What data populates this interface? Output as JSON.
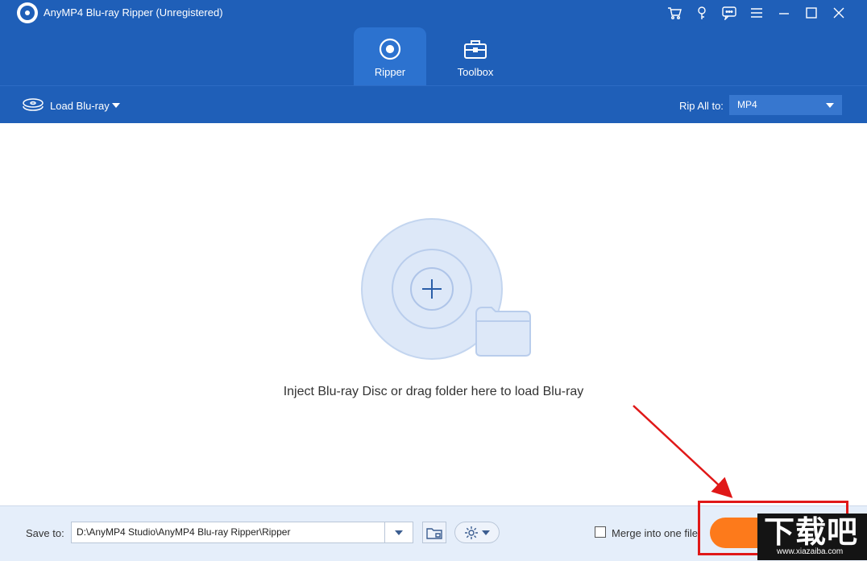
{
  "window": {
    "title": "AnyMP4 Blu-ray Ripper (Unregistered)",
    "icons": [
      "cart-icon",
      "key-icon",
      "chat-icon",
      "menu-icon",
      "minimize-icon",
      "maximize-icon",
      "close-icon"
    ]
  },
  "tabs": [
    {
      "label": "Ripper",
      "active": true,
      "icon": "disc-icon"
    },
    {
      "label": "Toolbox",
      "active": false,
      "icon": "toolbox-icon"
    }
  ],
  "toolbar": {
    "load_label": "Load Blu-ray",
    "rip_all_label": "Rip All to:",
    "format_value": "MP4"
  },
  "main": {
    "drop_hint": "Inject Blu-ray Disc or drag folder here to load Blu-ray"
  },
  "footer": {
    "save_label": "Save to:",
    "save_path": "D:\\AnyMP4 Studio\\AnyMP4 Blu-ray Ripper\\Ripper",
    "merge_label": "Merge into one file",
    "merge_checked": false
  },
  "watermark": {
    "text": "下载吧",
    "sub": "www.xiazaiba.com"
  },
  "colors": {
    "header": "#1f5fb8",
    "active_tab": "#2c72cf",
    "rip_button": "#fd7a1b",
    "highlight": "#e01818"
  }
}
